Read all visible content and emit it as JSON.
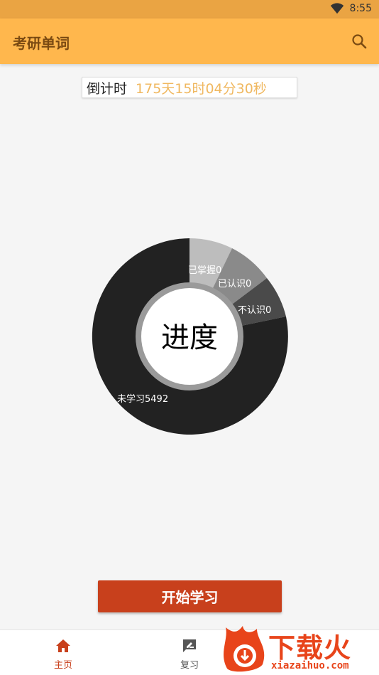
{
  "status_bar": {
    "time": "8:55"
  },
  "app_bar": {
    "title": "考研单词"
  },
  "countdown": {
    "label": "倒计时",
    "value": "175天15时04分30秒"
  },
  "chart_data": {
    "type": "pie",
    "title": "进度",
    "slices": [
      {
        "label": "已掌握",
        "value": 0,
        "text": "已掌握0",
        "color": "#bdbdbd"
      },
      {
        "label": "已认识",
        "value": 0,
        "text": "已认识0",
        "color": "#8a8a8a"
      },
      {
        "label": "不认识",
        "value": 0,
        "text": "不认识0",
        "color": "#4a4a4a"
      },
      {
        "label": "未学习",
        "value": 5492,
        "text": "未学习5492",
        "color": "#222222"
      }
    ]
  },
  "start_button": {
    "label": "开始学习"
  },
  "bottom_nav": {
    "items": [
      {
        "label": "主页",
        "icon": "home-icon",
        "active": true
      },
      {
        "label": "复习",
        "icon": "review-icon",
        "active": false
      }
    ]
  },
  "watermark": {
    "text": "下载火",
    "url": "xiazaihuo.com"
  },
  "colors": {
    "accent": "#ffb74d",
    "status_bar": "#eaa443",
    "primary_button": "#c8401c",
    "countdown_value": "#f0b860"
  }
}
